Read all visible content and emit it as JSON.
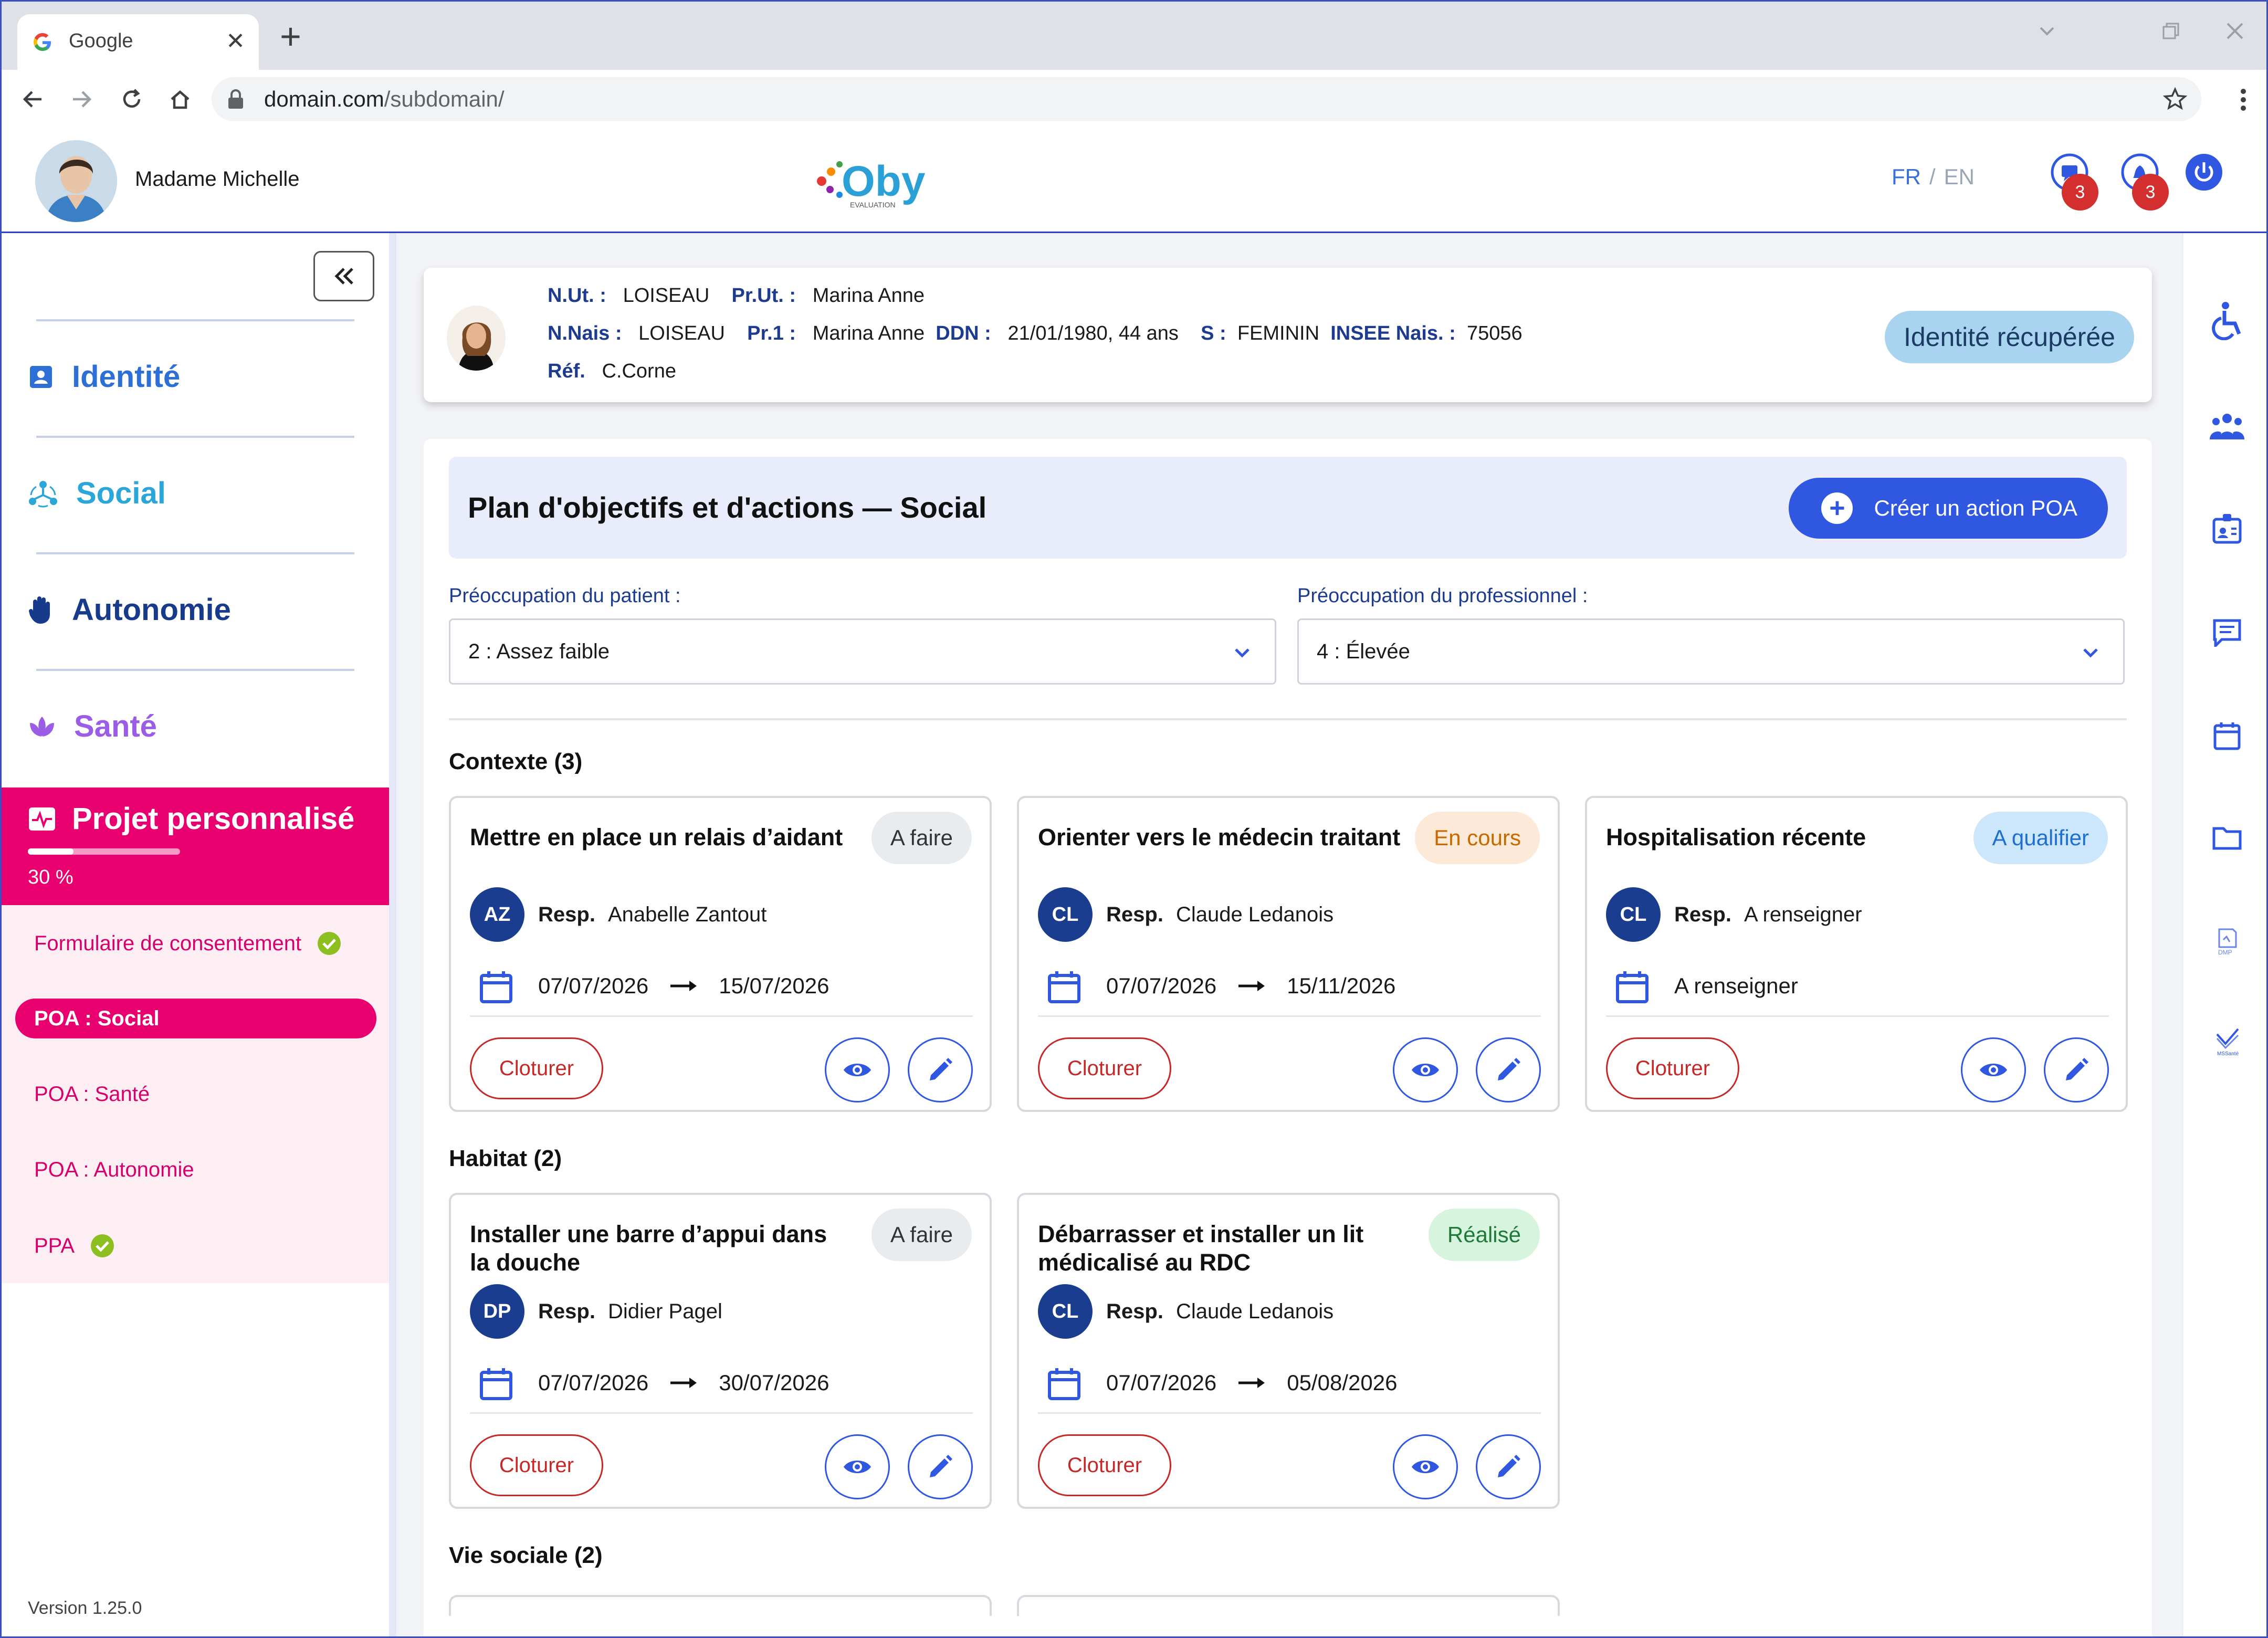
{
  "browser": {
    "tab_title": "Google",
    "url_domain": "domain.com",
    "url_path": "/subdomain/"
  },
  "header": {
    "user_name": "Madame Michelle",
    "lang_fr": "FR",
    "lang_sep": "/",
    "lang_en": "EN",
    "messages_count": "3",
    "notifications_count": "3",
    "logo_sub": "EVALUATION"
  },
  "sidebar": {
    "items": [
      {
        "label": "Identité",
        "color": "#2e6fd6"
      },
      {
        "label": "Social",
        "color": "#2aa6d8"
      },
      {
        "label": "Autonomie",
        "color": "#173a8a"
      },
      {
        "label": "Santé",
        "color": "#9b5de5"
      }
    ],
    "projet": {
      "label": "Projet personnalisé",
      "progress_text": "30 %",
      "progress": 0.3
    },
    "subnav": [
      {
        "label": "Formulaire de consentement",
        "checked": true
      },
      {
        "label": "POA : Social",
        "active": true
      },
      {
        "label": "POA : Santé"
      },
      {
        "label": "POA : Autonomie"
      },
      {
        "label": "PPA",
        "checked": true
      }
    ],
    "version": "Version 1.25.0"
  },
  "identity": {
    "nut_label": "N.Ut. :",
    "nut": "LOISEAU",
    "prut_label": "Pr.Ut. :",
    "prut": "Marina Anne",
    "nnais_label": "N.Nais :",
    "nnais": "LOISEAU",
    "pr1_label": "Pr.1 :",
    "pr1": "Marina Anne",
    "ddn_label": "DDN :",
    "ddn": "21/01/1980, 44 ans",
    "sexe_label": "S :",
    "sexe": "FEMININ",
    "insee_label": "INSEE Nais. :",
    "insee": "75056",
    "ref_label": "Réf.",
    "ref": "C.Corne",
    "status_chip": "Identité récupérée"
  },
  "panel": {
    "title": "Plan d'objectifs et d'actions — Social",
    "create_button": "Créer un action POA",
    "patient_label": "Préoccupation du patient :",
    "patient_value": "2 : Assez faible",
    "pro_label": "Préoccupation du professionnel :",
    "pro_value": "4 : Élevée",
    "groups": [
      {
        "title": "Contexte (3)",
        "cards": [
          {
            "title": "Mettre en place un relais d’aidant",
            "status": "A faire",
            "initials": "AZ",
            "resp_label": "Resp.",
            "resp": "Anabelle Zantout",
            "start": "07/07/2026",
            "end": "15/07/2026",
            "close": "Cloturer"
          },
          {
            "title": "Orienter vers le médecin traitant",
            "status": "En cours",
            "initials": "CL",
            "resp_label": "Resp.",
            "resp": "Claude Ledanois",
            "start": "07/07/2026",
            "end": "15/11/2026",
            "close": "Cloturer"
          },
          {
            "title": "Hospitalisation récente",
            "status": "A qualifier",
            "initials": "CL",
            "resp_label": "Resp.",
            "resp": "A renseigner",
            "start": "A renseigner",
            "end": "",
            "close": "Cloturer"
          }
        ]
      },
      {
        "title": "Habitat (2)",
        "cards": [
          {
            "title": "Installer une barre d’appui dans la douche",
            "status": "A faire",
            "initials": "DP",
            "resp_label": "Resp.",
            "resp": "Didier Pagel",
            "start": "07/07/2026",
            "end": "30/07/2026",
            "close": "Cloturer"
          },
          {
            "title": "Débarrasser et installer un lit médicalisé au RDC",
            "status": "Réalisé",
            "initials": "CL",
            "resp_label": "Resp.",
            "resp": "Claude Ledanois",
            "start": "07/07/2026",
            "end": "05/08/2026",
            "close": "Cloturer"
          }
        ]
      },
      {
        "title": "Vie sociale (2)",
        "cards": []
      }
    ]
  },
  "colors": {
    "accent_blue": "#2f57e0",
    "pink": "#e8006f",
    "navy": "#1a3d8f",
    "close_red": "#c62828"
  }
}
